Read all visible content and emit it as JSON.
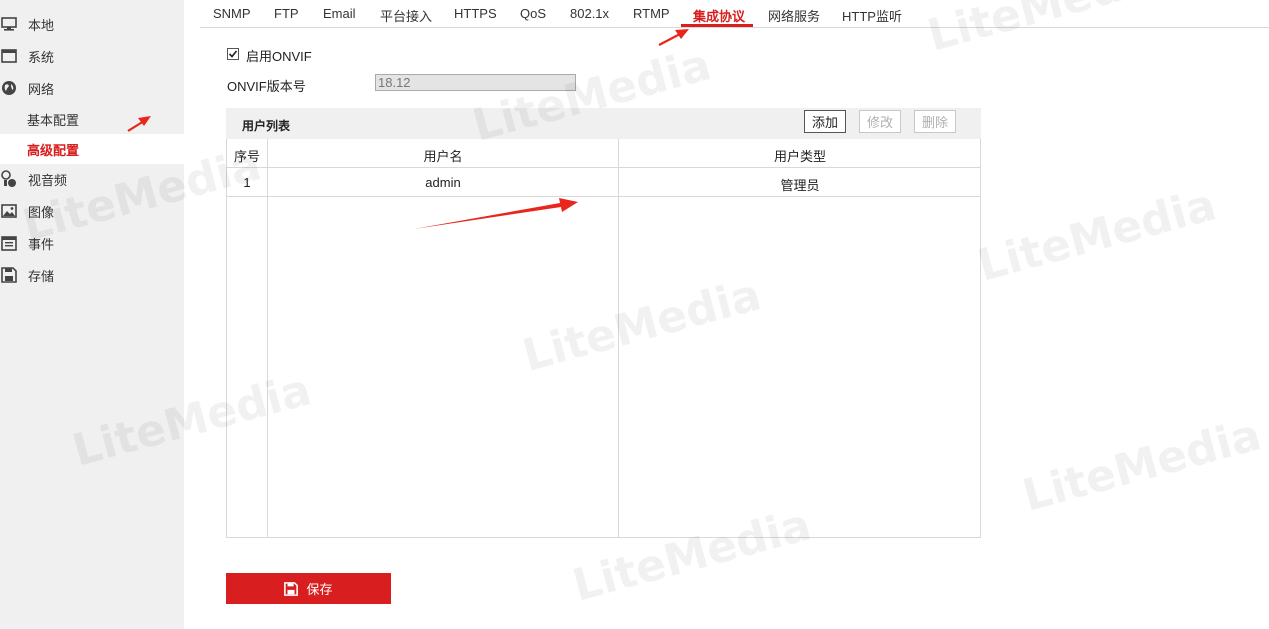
{
  "sidebar": {
    "items": [
      {
        "label": "本地",
        "icon": "monitor-icon"
      },
      {
        "label": "系统",
        "icon": "window-icon"
      },
      {
        "label": "网络",
        "icon": "globe-icon"
      },
      {
        "label": "视音频",
        "icon": "av-icon"
      },
      {
        "label": "图像",
        "icon": "image-icon"
      },
      {
        "label": "事件",
        "icon": "calendar-icon"
      },
      {
        "label": "存储",
        "icon": "save-disk-icon"
      }
    ],
    "sub_items": [
      {
        "label": "基本配置",
        "active": false
      },
      {
        "label": "高级配置",
        "active": true
      }
    ]
  },
  "tabs": [
    {
      "label": "SNMP"
    },
    {
      "label": "FTP"
    },
    {
      "label": "Email"
    },
    {
      "label": "平台接入"
    },
    {
      "label": "HTTPS"
    },
    {
      "label": "QoS"
    },
    {
      "label": "802.1x"
    },
    {
      "label": "RTMP"
    },
    {
      "label": "集成协议",
      "active": true
    },
    {
      "label": "网络服务"
    },
    {
      "label": "HTTP监听"
    }
  ],
  "form": {
    "enable_onvif_label": "启用ONVIF",
    "enable_onvif_checked": true,
    "version_label": "ONVIF版本号",
    "version_value": "18.12"
  },
  "user_list": {
    "title": "用户列表",
    "add_label": "添加",
    "modify_label": "修改",
    "delete_label": "删除",
    "columns": [
      "序号",
      "用户名",
      "用户类型"
    ],
    "rows": [
      {
        "index": "1",
        "username": "admin",
        "type": "管理员"
      }
    ]
  },
  "save_label": "保存",
  "watermark": "LiteMedia",
  "colors": {
    "accent": "#d81e1e",
    "sidebar_bg": "#f0f0f0",
    "border": "#d8d8d8"
  }
}
